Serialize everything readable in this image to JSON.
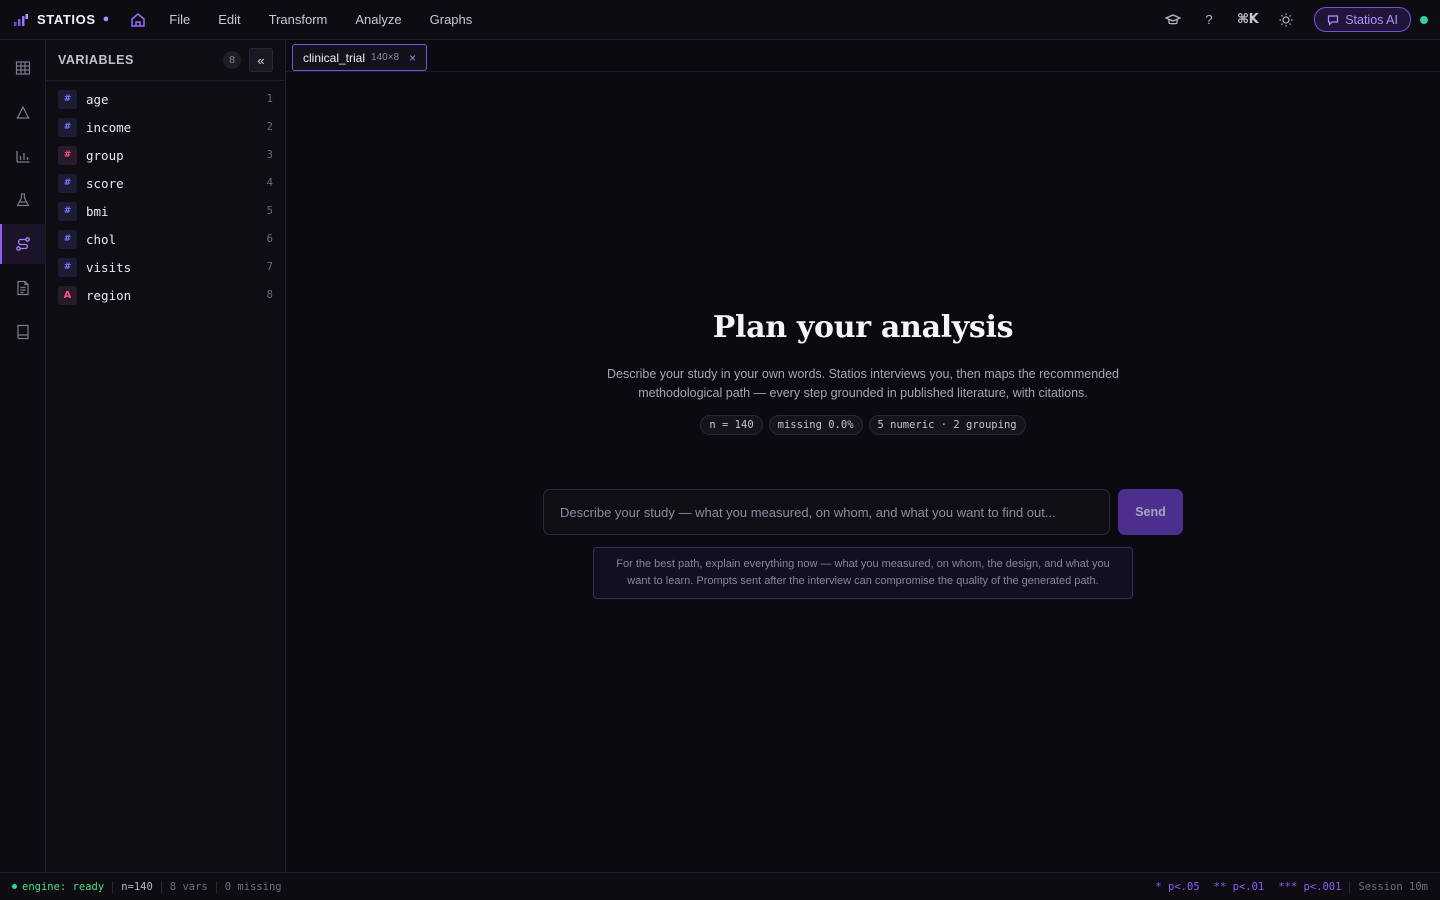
{
  "app": {
    "name": "STATIOS",
    "menu": [
      "File",
      "Edit",
      "Transform",
      "Analyze",
      "Graphs"
    ],
    "shortcut": "⌘K",
    "ai_button": "Statios AI",
    "accent": "#8b5cf6",
    "status_color": "#34d399"
  },
  "rail": {
    "items": [
      {
        "icon": "table-icon"
      },
      {
        "icon": "distribution-icon"
      },
      {
        "icon": "bar-chart-icon"
      },
      {
        "icon": "flask-icon"
      },
      {
        "icon": "path-icon",
        "active": true
      },
      {
        "icon": "document-icon"
      },
      {
        "icon": "book-icon"
      }
    ]
  },
  "variables": {
    "title": "VARIABLES",
    "count": "8",
    "collapse_label": "«",
    "items": [
      {
        "name": "age",
        "type": "#",
        "index": "1",
        "color": "#7b78ff"
      },
      {
        "name": "income",
        "type": "#",
        "index": "2",
        "color": "#7b78ff"
      },
      {
        "name": "group",
        "type": "#",
        "index": "3",
        "color": "#ff4f8b"
      },
      {
        "name": "score",
        "type": "#",
        "index": "4",
        "color": "#7b78ff"
      },
      {
        "name": "bmi",
        "type": "#",
        "index": "5",
        "color": "#7b78ff"
      },
      {
        "name": "chol",
        "type": "#",
        "index": "6",
        "color": "#7b78ff"
      },
      {
        "name": "visits",
        "type": "#",
        "index": "7",
        "color": "#7b78ff"
      },
      {
        "name": "region",
        "type": "A",
        "index": "8",
        "color": "#ff4f8b"
      }
    ]
  },
  "tab": {
    "name": "clinical_trial",
    "dims": "140×8",
    "close": "×"
  },
  "hero": {
    "title": "Plan your analysis",
    "description": "Describe your study in your own words. Statios interviews you, then maps the recommended methodological path — every step grounded in published literature, with citations.",
    "chips": [
      "n = 140",
      "missing 0.0%",
      "5 numeric · 2 grouping"
    ]
  },
  "prompt": {
    "value": "",
    "placeholder": "Describe your study — what you measured, on whom, and what you want to find out...",
    "send_label": "Send",
    "hint": "For the best path, explain everything now — what you measured, on whom, the design, and what you want to learn. Prompts sent after the interview can compromise the quality of the generated path."
  },
  "status": {
    "engine": "engine: ready",
    "n": "n=140",
    "vars": "8 vars",
    "missing": "0 missing",
    "sig1": "* p<.05",
    "sig2": "** p<.01",
    "sig3": "*** p<.001",
    "session": "Session 10m"
  }
}
